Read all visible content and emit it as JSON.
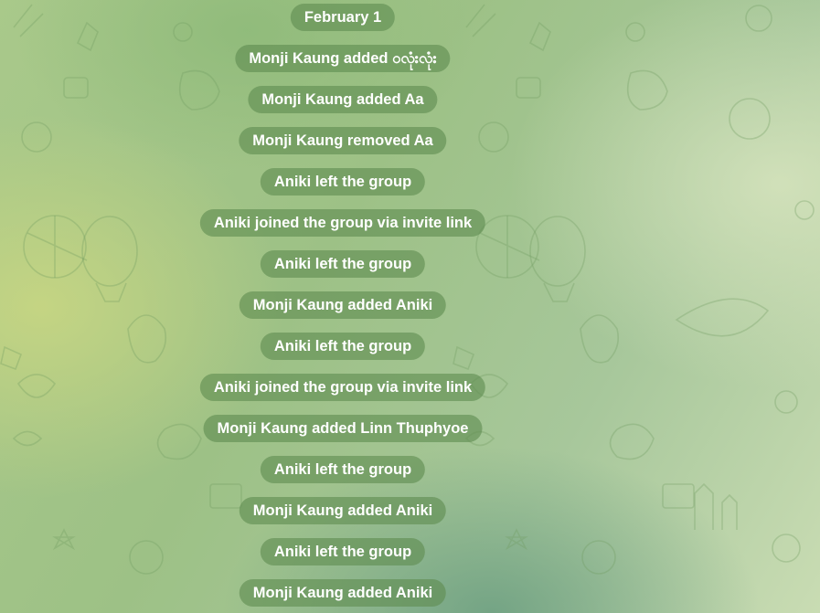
{
  "chat": {
    "date_divider": "February 1",
    "events": [
      "Monji Kaung added ဝလုံးလုံး",
      "Monji Kaung added Aa",
      "Monji Kaung removed Aa",
      "Aniki left the group",
      "Aniki joined the group via invite link",
      "Aniki left the group",
      "Monji Kaung added Aniki",
      "Aniki left the group",
      "Aniki joined the group via invite link",
      "Monji Kaung added Linn Thuphyoe",
      "Aniki left the group",
      "Monji Kaung added Aniki",
      "Aniki left the group",
      "Monji Kaung added Aniki"
    ]
  },
  "colors": {
    "pill_background": "#5f8c50",
    "pill_text": "#ffffff"
  }
}
